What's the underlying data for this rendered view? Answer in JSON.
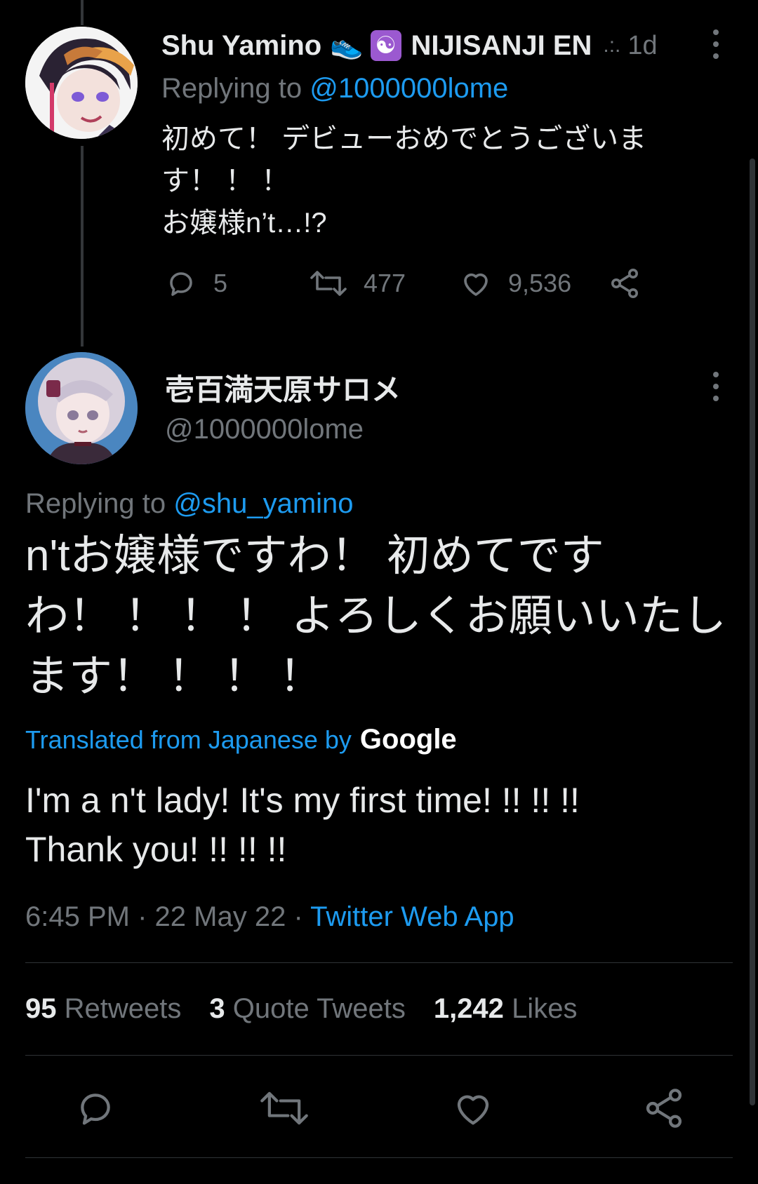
{
  "parent_tweet": {
    "display_name": "Shu Yamino",
    "name_emoji_1": "👟",
    "name_emoji_2": "☯",
    "org": "NIJISANJI EN",
    "truncation": ".:.",
    "time_ago": "1d",
    "replying_prefix": "Replying to",
    "replying_handle": "@1000000lome",
    "text_line1": "初めて！ デビューおめでとうございま",
    "text_line2": "す！ ！ ！",
    "text_line3": "お嬢様n’t…!?",
    "reply_count": "5",
    "retweet_count": "477",
    "like_count": "9,536"
  },
  "main_tweet": {
    "display_name": "壱百満天原サロメ",
    "handle": "@1000000lome",
    "replying_prefix": "Replying to",
    "replying_handle": "@shu_yamino",
    "text_line1": "n'tお嬢様ですわ！ 初めてです",
    "text_line2": "わ！ ！ ！ ！ よろしくお願いいたし",
    "text_line3": "ます！ ！ ！ ！",
    "translated_label": "Translated from Japanese by",
    "translator_brand": "Google",
    "translation_line1": "I'm a n't lady! It's my first time! !! !! !!",
    "translation_line2": "Thank you! !! !! !!",
    "time": "6:45 PM",
    "sep": "·",
    "date": "22 May 22",
    "source": "Twitter Web App"
  },
  "stats": {
    "retweets_count": "95",
    "retweets_label": "Retweets",
    "quotes_count": "3",
    "quotes_label": "Quote Tweets",
    "likes_count": "1,242",
    "likes_label": "Likes"
  },
  "icons": [
    "reply-icon",
    "retweet-icon",
    "like-icon",
    "share-icon",
    "more-icon"
  ],
  "colors": {
    "background": "#000000",
    "text": "#e7e9ea",
    "muted": "#71767b",
    "link": "#1d9bf0",
    "divider": "#2f3336"
  }
}
